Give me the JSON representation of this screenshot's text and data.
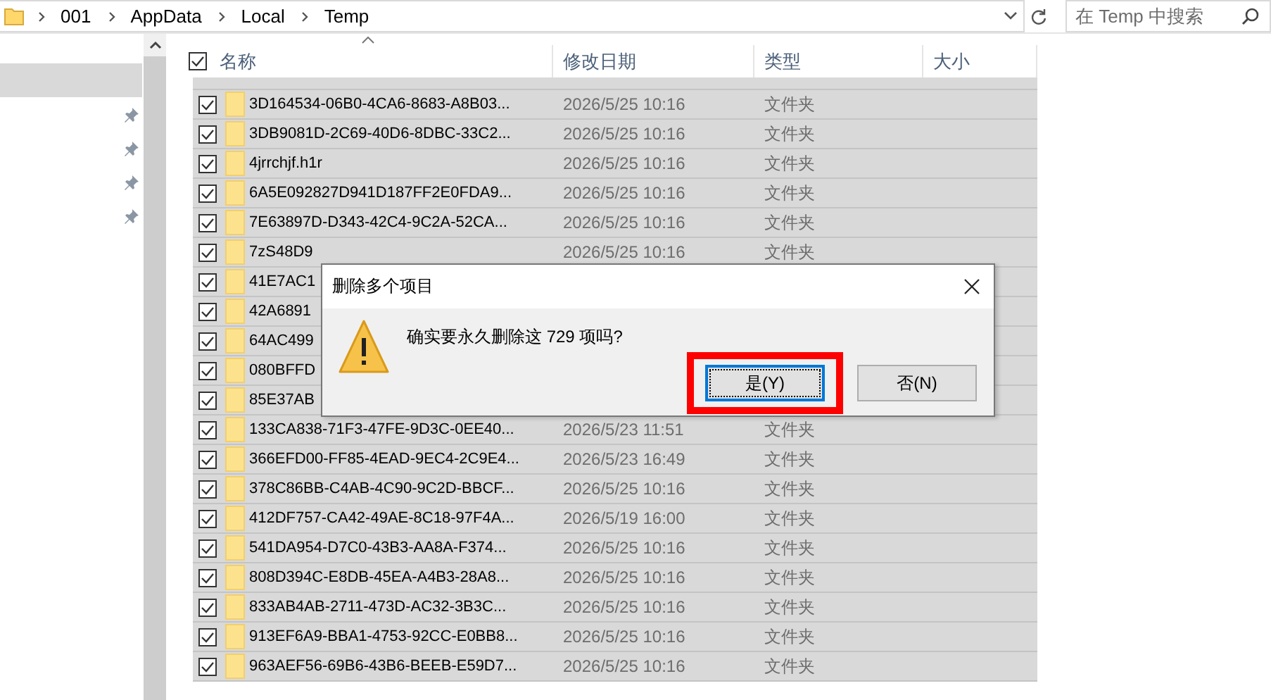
{
  "address_bar": {
    "path": [
      "001",
      "AppData",
      "Local",
      "Temp"
    ]
  },
  "search": {
    "placeholder": "在 Temp 中搜索"
  },
  "table": {
    "select_all": {
      "checked": true
    },
    "columns": [
      {
        "label": "名称",
        "sorted": true
      },
      {
        "label": "修改日期",
        "sorted": false
      },
      {
        "label": "类型",
        "sorted": false
      },
      {
        "label": "大小",
        "sorted": false
      }
    ],
    "rows": [
      {
        "name": "3D164534-06B0-4CA6-8683-A8B03...",
        "modified": "2026/5/25 10:16",
        "type": "文件夹",
        "checked": true
      },
      {
        "name": "3DB9081D-2C69-40D6-8DBC-33C2...",
        "modified": "2026/5/25 10:16",
        "type": "文件夹",
        "checked": true
      },
      {
        "name": "4jrrchjf.h1r",
        "modified": "2026/5/25 10:16",
        "type": "文件夹",
        "checked": true
      },
      {
        "name": "6A5E092827D941D187FF2E0FDA9...",
        "modified": "2026/5/25 10:16",
        "type": "文件夹",
        "checked": true
      },
      {
        "name": "7E63897D-D343-42C4-9C2A-52CA...",
        "modified": "2026/5/25 10:16",
        "type": "文件夹",
        "checked": true
      },
      {
        "name": "7zS48D9",
        "modified": "2026/5/25 10:16",
        "type": "文件夹",
        "checked": true
      },
      {
        "name": "41E7AC1",
        "checked": true
      },
      {
        "name": "42A6891",
        "checked": true
      },
      {
        "name": "64AC499",
        "checked": true
      },
      {
        "name": "080BFFD",
        "checked": true
      },
      {
        "name": "85E37AB",
        "checked": true
      },
      {
        "name": "133CA838-71F3-47FE-9D3C-0EE40...",
        "modified": "2026/5/23 11:51",
        "type": "文件夹",
        "checked": true
      },
      {
        "name": "366EFD00-FF85-4EAD-9EC4-2C9E4...",
        "modified": "2026/5/23 16:49",
        "type": "文件夹",
        "checked": true
      },
      {
        "name": "378C86BB-C4AB-4C90-9C2D-BBCF...",
        "modified": "2026/5/25 10:16",
        "type": "文件夹",
        "checked": true
      },
      {
        "name": "412DF757-CA42-49AE-8C18-97F4A...",
        "modified": "2026/5/19 16:00",
        "type": "文件夹",
        "checked": true
      },
      {
        "name": "541DA954-D7C0-43B3-AA8A-F374...",
        "modified": "2026/5/25 10:16",
        "type": "文件夹",
        "checked": true
      },
      {
        "name": "808D394C-E8DB-45EA-A4B3-28A8...",
        "modified": "2026/5/25 10:16",
        "type": "文件夹",
        "checked": true
      },
      {
        "name": "833AB4AB-2711-473D-AC32-3B3C...",
        "modified": "2026/5/25 10:16",
        "type": "文件夹",
        "checked": true
      },
      {
        "name": "913EF6A9-BBA1-4753-92CC-E0BB8...",
        "modified": "2026/5/25 10:16",
        "type": "文件夹",
        "checked": true
      },
      {
        "name": "963AEF56-69B6-43B6-BEEB-E59D7...",
        "modified": "2026/5/25 10:16",
        "type": "文件夹",
        "checked": true
      }
    ]
  },
  "dialog": {
    "title": "删除多个项目",
    "message": "确实要永久删除这 729 项吗?",
    "buttons": [
      {
        "label": "是(Y)",
        "selected": true,
        "highlighted": true
      },
      {
        "label": "否(N)",
        "selected": false,
        "highlighted": false
      }
    ]
  }
}
